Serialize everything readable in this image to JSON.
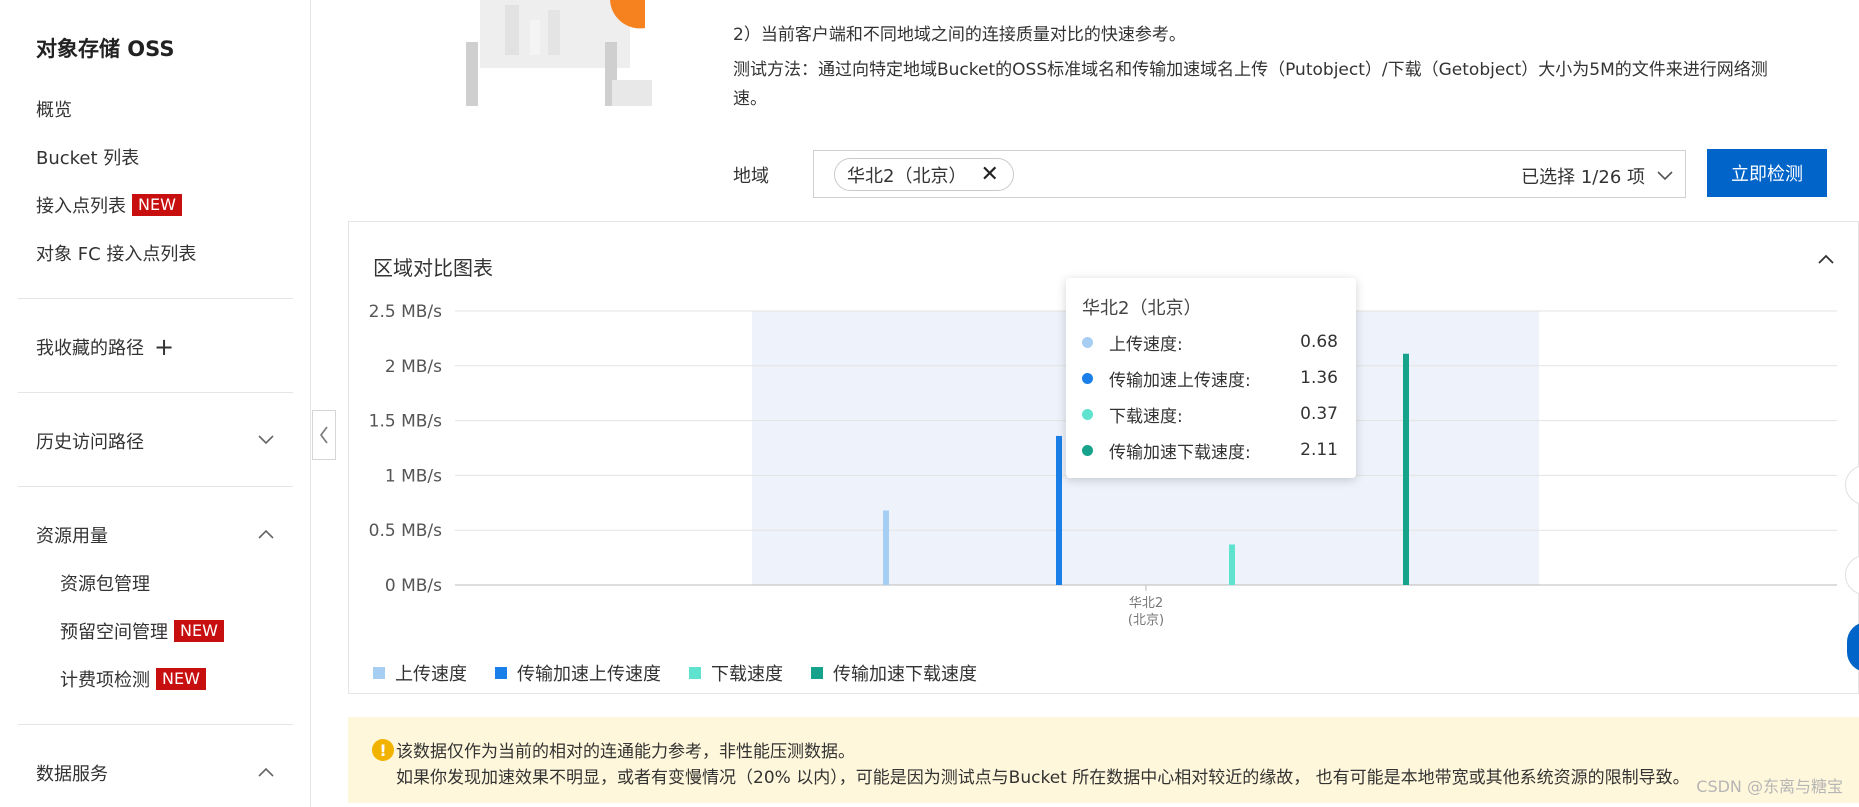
{
  "sidebar": {
    "title": "对象存储 OSS",
    "items": [
      {
        "label": "概览"
      },
      {
        "label": "Bucket 列表"
      },
      {
        "label": "接入点列表",
        "badge": "NEW"
      },
      {
        "label": "对象 FC 接入点列表"
      },
      {
        "label": "我收藏的路径"
      },
      {
        "label": "历史访问路径"
      },
      {
        "label": "资源用量"
      },
      {
        "label": "资源包管理"
      },
      {
        "label": "预留空间管理",
        "badge": "NEW"
      },
      {
        "label": "计费项检测",
        "badge": "NEW"
      },
      {
        "label": "数据服务"
      }
    ]
  },
  "info": {
    "line2": "2）当前客户端和不同地域之间的连接质量对比的快速参考。",
    "line3": "测试方法：通过向特定地域Bucket的OSS标准域名和传输加速域名上传（Putobject）/下载（Getobject）大小为5M的文件来进行网络测",
    "line4": "速。"
  },
  "region": {
    "label": "地域",
    "tag": "华北2（北京）",
    "selected_count": "已选择 1/26 项",
    "button": "立即检测"
  },
  "chart_card": {
    "title": "区域对比图表"
  },
  "chart_data": {
    "type": "bar",
    "categories": [
      "华北2\n(北京)"
    ],
    "category_lines": [
      "华北2",
      "(北京)"
    ],
    "series": [
      {
        "name": "上传速度",
        "values": [
          0.68
        ],
        "color": "#a6cdf2"
      },
      {
        "name": "传输加速上传速度",
        "values": [
          1.36
        ],
        "color": "#1a7fe8"
      },
      {
        "name": "下载速度",
        "values": [
          0.37
        ],
        "color": "#5fe3cf"
      },
      {
        "name": "传输加速下载速度",
        "values": [
          2.11
        ],
        "color": "#17a38b"
      }
    ],
    "y_ticks": [
      "0 MB/s",
      "0.5 MB/s",
      "1 MB/s",
      "1.5 MB/s",
      "2 MB/s",
      "2.5 MB/s"
    ],
    "ylim": [
      0,
      2.5
    ],
    "grid": true,
    "legend_position": "bottom-left"
  },
  "tooltip": {
    "title": "华北2（北京）",
    "rows": [
      {
        "name": "上传速度:",
        "value": "0.68",
        "color": "#a6cdf2"
      },
      {
        "name": "传输加速上传速度:",
        "value": "1.36",
        "color": "#1a7fe8"
      },
      {
        "name": "下载速度:",
        "value": "0.37",
        "color": "#5fe3cf"
      },
      {
        "name": "传输加速下载速度:",
        "value": "2.11",
        "color": "#17a38b"
      }
    ]
  },
  "notice": {
    "line1": "该数据仅作为当前的相对的连通能力参考，非性能压测数据。",
    "line2": "如果你发现加速效果不明显，或者有变慢情况（20% 以内），可能是因为测试点与Bucket 所在数据中心相对较近的缘故， 也有可能是本地带宽或其他系统资源的限制导致。",
    "watermark": "CSDN @东离与糖宝"
  }
}
